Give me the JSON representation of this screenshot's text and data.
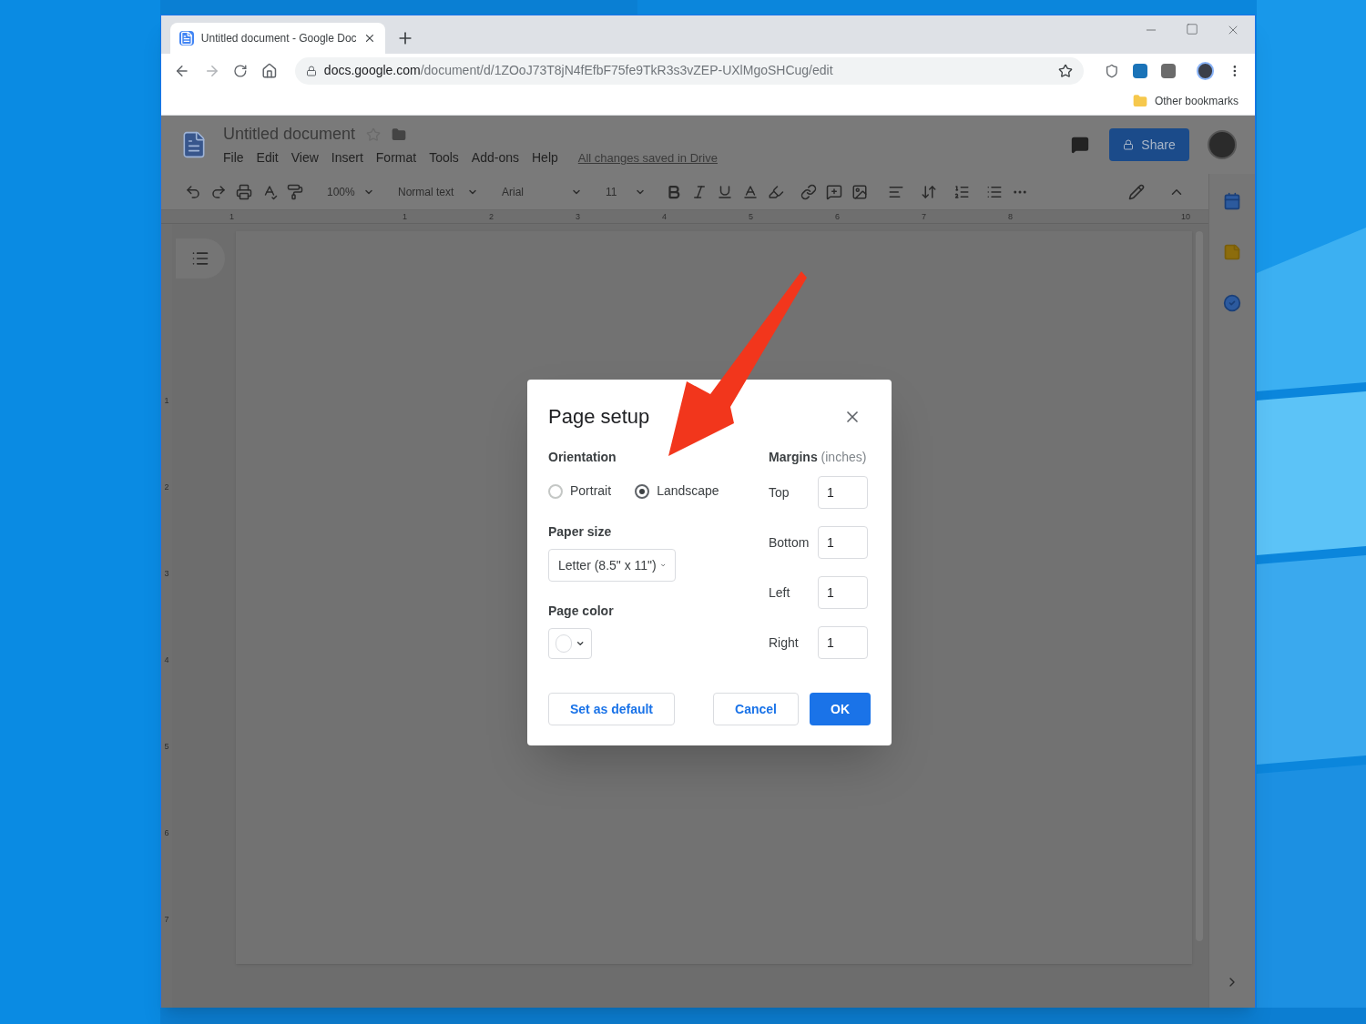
{
  "browser": {
    "tabs": [
      {
        "title": "Untitled document - Google Doc",
        "selected": true
      }
    ],
    "url": {
      "domain": "docs.google.com",
      "path": "/document/d/1ZOoJ73T8jN4fEfbF75fe9TkR3s3vZEP-UXlMgoSHCug/edit"
    },
    "bookmarks": [
      "Other bookmarks"
    ]
  },
  "docs": {
    "title": "Untitled document",
    "menu": [
      "File",
      "Edit",
      "View",
      "Insert",
      "Format",
      "Tools",
      "Add-ons",
      "Help"
    ],
    "save_status": "All changes saved in Drive",
    "share": "Share",
    "toolbar": {
      "zoom": "100%",
      "style": "Normal text",
      "font": "Arial",
      "size": "11"
    },
    "ruler": [
      "1",
      "1",
      "2",
      "3",
      "4",
      "5",
      "6",
      "7",
      "8",
      "10"
    ],
    "vertical_ruler": [
      "1",
      "2",
      "3",
      "4",
      "5",
      "6",
      "7"
    ]
  },
  "dialog": {
    "title": "Page setup",
    "orientation_label": "Orientation",
    "orientations": [
      {
        "label": "Portrait",
        "selected": false
      },
      {
        "label": "Landscape",
        "selected": true
      }
    ],
    "paper_size_label": "Paper size",
    "paper_size": "Letter (8.5\" x 11\")",
    "page_color_label": "Page color",
    "margins_label": "Margins",
    "margins_unit": "(inches)",
    "margins": [
      {
        "label": "Top",
        "value": "1"
      },
      {
        "label": "Bottom",
        "value": "1"
      },
      {
        "label": "Left",
        "value": "1"
      },
      {
        "label": "Right",
        "value": "1"
      }
    ],
    "buttons": [
      {
        "label": "Set as default",
        "kind": "secondary"
      },
      {
        "label": "Cancel",
        "kind": "secondary"
      },
      {
        "label": "OK",
        "kind": "primary"
      }
    ]
  }
}
